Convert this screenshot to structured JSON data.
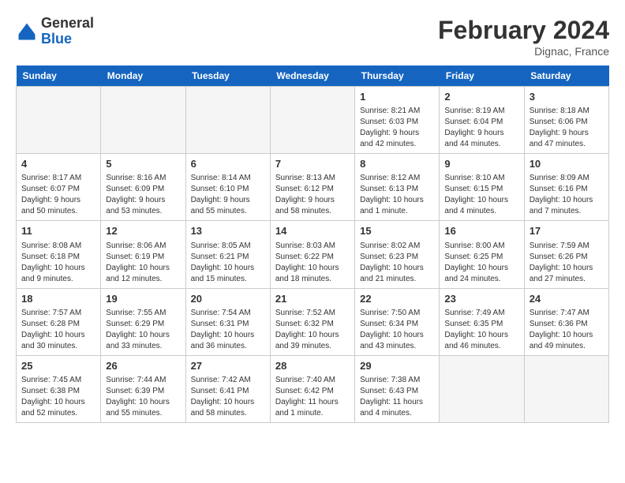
{
  "header": {
    "logo_general": "General",
    "logo_blue": "Blue",
    "month_year": "February 2024",
    "location": "Dignac, France"
  },
  "days_of_week": [
    "Sunday",
    "Monday",
    "Tuesday",
    "Wednesday",
    "Thursday",
    "Friday",
    "Saturday"
  ],
  "weeks": [
    [
      {
        "day": "",
        "info": ""
      },
      {
        "day": "",
        "info": ""
      },
      {
        "day": "",
        "info": ""
      },
      {
        "day": "",
        "info": ""
      },
      {
        "day": "1",
        "info": "Sunrise: 8:21 AM\nSunset: 6:03 PM\nDaylight: 9 hours and 42 minutes."
      },
      {
        "day": "2",
        "info": "Sunrise: 8:19 AM\nSunset: 6:04 PM\nDaylight: 9 hours and 44 minutes."
      },
      {
        "day": "3",
        "info": "Sunrise: 8:18 AM\nSunset: 6:06 PM\nDaylight: 9 hours and 47 minutes."
      }
    ],
    [
      {
        "day": "4",
        "info": "Sunrise: 8:17 AM\nSunset: 6:07 PM\nDaylight: 9 hours and 50 minutes."
      },
      {
        "day": "5",
        "info": "Sunrise: 8:16 AM\nSunset: 6:09 PM\nDaylight: 9 hours and 53 minutes."
      },
      {
        "day": "6",
        "info": "Sunrise: 8:14 AM\nSunset: 6:10 PM\nDaylight: 9 hours and 55 minutes."
      },
      {
        "day": "7",
        "info": "Sunrise: 8:13 AM\nSunset: 6:12 PM\nDaylight: 9 hours and 58 minutes."
      },
      {
        "day": "8",
        "info": "Sunrise: 8:12 AM\nSunset: 6:13 PM\nDaylight: 10 hours and 1 minute."
      },
      {
        "day": "9",
        "info": "Sunrise: 8:10 AM\nSunset: 6:15 PM\nDaylight: 10 hours and 4 minutes."
      },
      {
        "day": "10",
        "info": "Sunrise: 8:09 AM\nSunset: 6:16 PM\nDaylight: 10 hours and 7 minutes."
      }
    ],
    [
      {
        "day": "11",
        "info": "Sunrise: 8:08 AM\nSunset: 6:18 PM\nDaylight: 10 hours and 9 minutes."
      },
      {
        "day": "12",
        "info": "Sunrise: 8:06 AM\nSunset: 6:19 PM\nDaylight: 10 hours and 12 minutes."
      },
      {
        "day": "13",
        "info": "Sunrise: 8:05 AM\nSunset: 6:21 PM\nDaylight: 10 hours and 15 minutes."
      },
      {
        "day": "14",
        "info": "Sunrise: 8:03 AM\nSunset: 6:22 PM\nDaylight: 10 hours and 18 minutes."
      },
      {
        "day": "15",
        "info": "Sunrise: 8:02 AM\nSunset: 6:23 PM\nDaylight: 10 hours and 21 minutes."
      },
      {
        "day": "16",
        "info": "Sunrise: 8:00 AM\nSunset: 6:25 PM\nDaylight: 10 hours and 24 minutes."
      },
      {
        "day": "17",
        "info": "Sunrise: 7:59 AM\nSunset: 6:26 PM\nDaylight: 10 hours and 27 minutes."
      }
    ],
    [
      {
        "day": "18",
        "info": "Sunrise: 7:57 AM\nSunset: 6:28 PM\nDaylight: 10 hours and 30 minutes."
      },
      {
        "day": "19",
        "info": "Sunrise: 7:55 AM\nSunset: 6:29 PM\nDaylight: 10 hours and 33 minutes."
      },
      {
        "day": "20",
        "info": "Sunrise: 7:54 AM\nSunset: 6:31 PM\nDaylight: 10 hours and 36 minutes."
      },
      {
        "day": "21",
        "info": "Sunrise: 7:52 AM\nSunset: 6:32 PM\nDaylight: 10 hours and 39 minutes."
      },
      {
        "day": "22",
        "info": "Sunrise: 7:50 AM\nSunset: 6:34 PM\nDaylight: 10 hours and 43 minutes."
      },
      {
        "day": "23",
        "info": "Sunrise: 7:49 AM\nSunset: 6:35 PM\nDaylight: 10 hours and 46 minutes."
      },
      {
        "day": "24",
        "info": "Sunrise: 7:47 AM\nSunset: 6:36 PM\nDaylight: 10 hours and 49 minutes."
      }
    ],
    [
      {
        "day": "25",
        "info": "Sunrise: 7:45 AM\nSunset: 6:38 PM\nDaylight: 10 hours and 52 minutes."
      },
      {
        "day": "26",
        "info": "Sunrise: 7:44 AM\nSunset: 6:39 PM\nDaylight: 10 hours and 55 minutes."
      },
      {
        "day": "27",
        "info": "Sunrise: 7:42 AM\nSunset: 6:41 PM\nDaylight: 10 hours and 58 minutes."
      },
      {
        "day": "28",
        "info": "Sunrise: 7:40 AM\nSunset: 6:42 PM\nDaylight: 11 hours and 1 minute."
      },
      {
        "day": "29",
        "info": "Sunrise: 7:38 AM\nSunset: 6:43 PM\nDaylight: 11 hours and 4 minutes."
      },
      {
        "day": "",
        "info": ""
      },
      {
        "day": "",
        "info": ""
      }
    ]
  ]
}
